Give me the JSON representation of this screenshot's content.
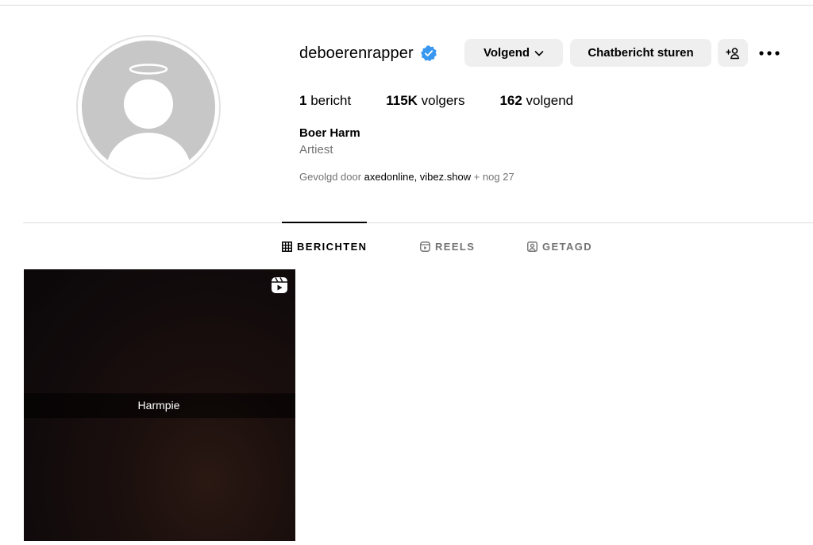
{
  "profile": {
    "username": "deboerenrapper",
    "verified": true,
    "full_name": "Boer Harm",
    "category": "Artiest",
    "avatar_icon": "default-avatar-icon"
  },
  "actions": {
    "following_label": "Volgend",
    "message_label": "Chatbericht sturen",
    "suggest_icon": "add-person-icon",
    "more_icon": "more-horizontal-icon"
  },
  "stats": {
    "posts_count": "1",
    "posts_label": " bericht",
    "followers_count": "115K",
    "followers_label": " volgers",
    "following_count": "162",
    "following_label": " volgend"
  },
  "followed_by": {
    "prefix": "Gevolgd door ",
    "account_1": "axedonline",
    "separator": ", ",
    "account_2": "vibez.show",
    "suffix": " + nog 27"
  },
  "tabs": [
    {
      "label": "BERICHTEN",
      "icon": "grid-icon",
      "active": true
    },
    {
      "label": "REELS",
      "icon": "reels-icon",
      "active": false
    },
    {
      "label": "GETAGD",
      "icon": "tagged-icon",
      "active": false
    }
  ],
  "posts": [
    {
      "caption": "Harmpie",
      "type_icon": "reel-badge-icon"
    }
  ],
  "colors": {
    "verified_blue": "#3897f0",
    "button_bg": "#efefef",
    "muted_text": "#737373",
    "divider": "#dbdbdb"
  }
}
